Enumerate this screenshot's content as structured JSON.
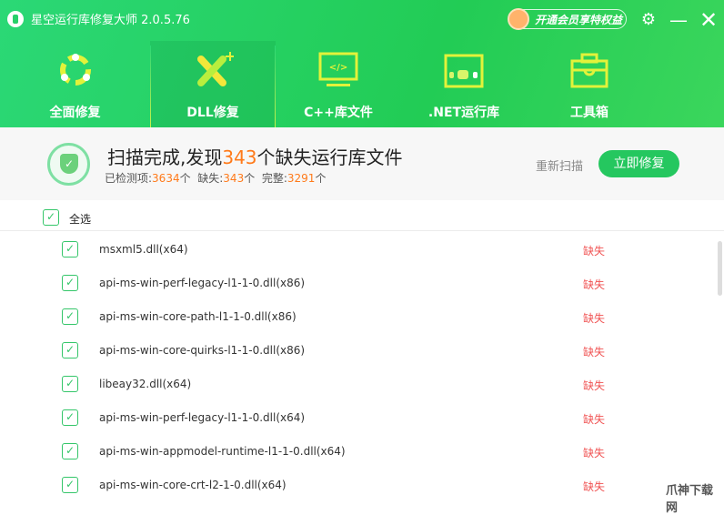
{
  "app": {
    "title": "星空运行库修复大师 2.0.5.76",
    "vip_label": "开通会员享特权益"
  },
  "tabs": [
    {
      "label": "全面修复"
    },
    {
      "label": "DLL修复"
    },
    {
      "label": "C++库文件"
    },
    {
      "label": ".NET运行库"
    },
    {
      "label": "工具箱"
    }
  ],
  "summary": {
    "prefix": "扫描完成,发现",
    "count": "343",
    "suffix": "个缺失运行库文件",
    "checked_label": "已检测项:",
    "checked": "3634",
    "missing_label": "缺失:",
    "missing": "343",
    "complete_label": "完整:",
    "complete": "3291",
    "unit": "个"
  },
  "actions": {
    "rescan": "重新扫描",
    "fix": "立即修复"
  },
  "list": {
    "select_all": "全选",
    "items": [
      {
        "name": "msxml5.dll(x64)",
        "status": "缺失"
      },
      {
        "name": "api-ms-win-perf-legacy-l1-1-0.dll(x86)",
        "status": "缺失"
      },
      {
        "name": "api-ms-win-core-path-l1-1-0.dll(x86)",
        "status": "缺失"
      },
      {
        "name": "api-ms-win-core-quirks-l1-1-0.dll(x86)",
        "status": "缺失"
      },
      {
        "name": "libeay32.dll(x64)",
        "status": "缺失"
      },
      {
        "name": "api-ms-win-perf-legacy-l1-1-0.dll(x64)",
        "status": "缺失"
      },
      {
        "name": "api-ms-win-appmodel-runtime-l1-1-0.dll(x64)",
        "status": "缺失"
      },
      {
        "name": "api-ms-win-core-crt-l2-1-0.dll(x64)",
        "status": "缺失"
      }
    ]
  },
  "watermark": "爪神下载网"
}
